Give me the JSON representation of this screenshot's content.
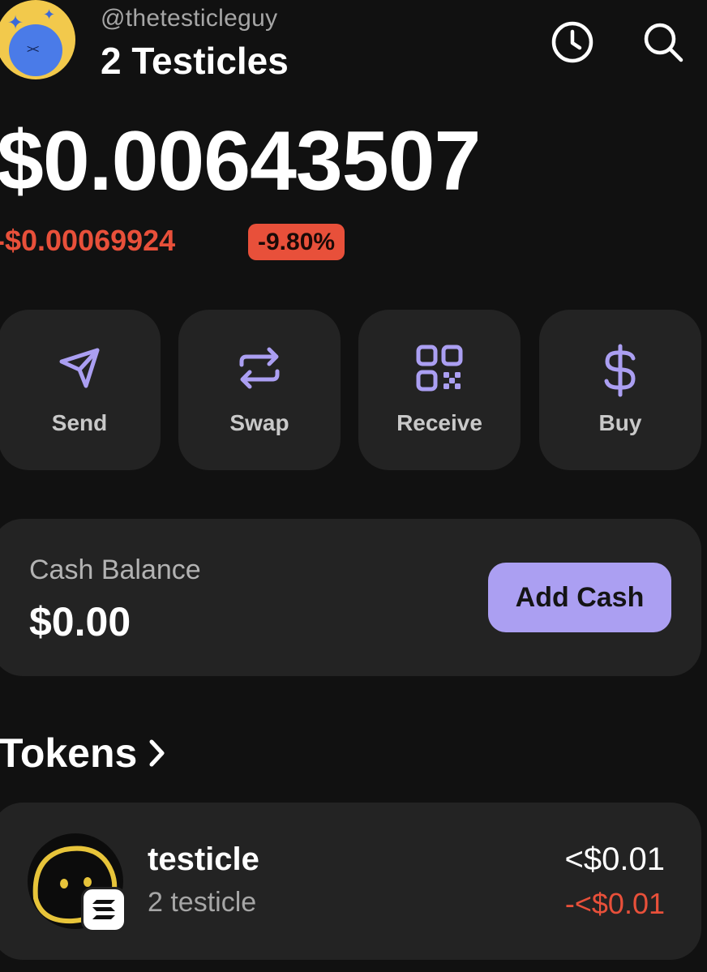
{
  "header": {
    "handle": "@thetesticleguy",
    "account_name": "2 Testicles"
  },
  "balance": {
    "total": "$0.00643507",
    "change_amount": "-$0.00069924",
    "change_percent": "-9.80%"
  },
  "actions": [
    {
      "label": "Send",
      "icon": "send-icon"
    },
    {
      "label": "Swap",
      "icon": "swap-icon"
    },
    {
      "label": "Receive",
      "icon": "qr-code-icon"
    },
    {
      "label": "Buy",
      "icon": "dollar-icon"
    }
  ],
  "cash": {
    "label": "Cash Balance",
    "value": "$0.00",
    "button": "Add Cash"
  },
  "tokens": {
    "title": "Tokens",
    "items": [
      {
        "name": "testicle",
        "quantity": "2 testicle",
        "value": "<$0.01",
        "change": "-<$0.01"
      }
    ]
  },
  "colors": {
    "background": "#111111",
    "card": "#232323",
    "accent": "#ab9ff2",
    "negative": "#e8503a"
  }
}
